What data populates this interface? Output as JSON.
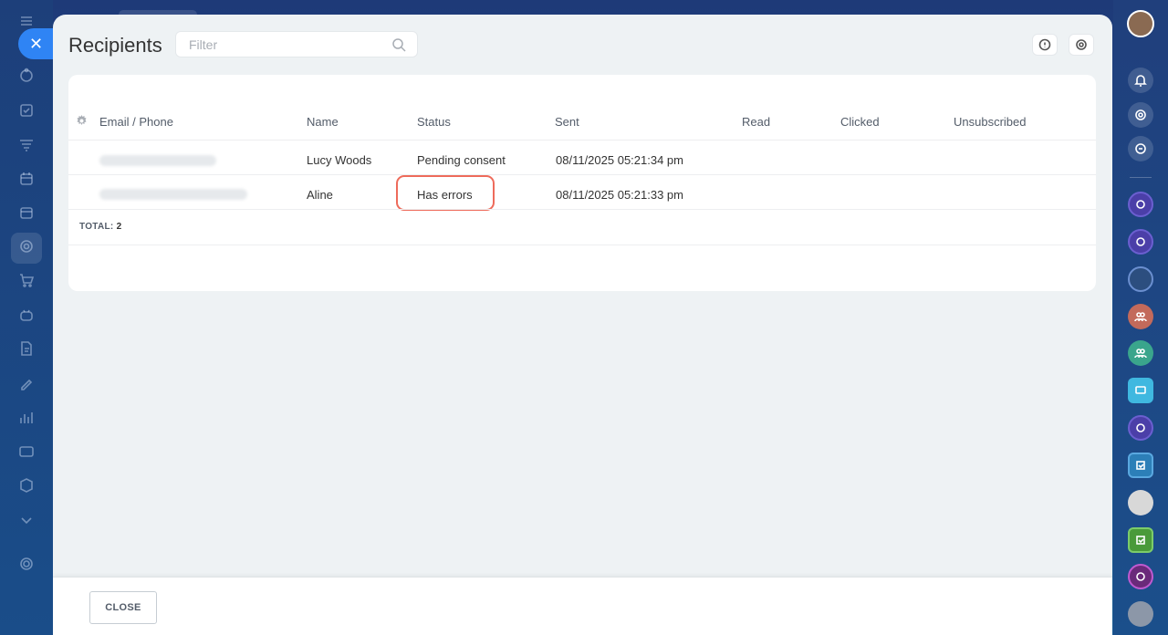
{
  "panel": {
    "title": "Recipients",
    "filter_placeholder": "Filter"
  },
  "table": {
    "columns": [
      "Email / Phone",
      "Name",
      "Status",
      "Sent",
      "Read",
      "Clicked",
      "Unsubscribed"
    ],
    "rows": [
      {
        "name": "Lucy Woods",
        "status": "Pending consent",
        "sent": "08/11/2025 05:21:34 pm"
      },
      {
        "name": "Aline",
        "status": "Has errors",
        "sent": "08/11/2025 05:21:33 pm"
      }
    ],
    "total_label": "TOTAL:",
    "total_value": "2"
  },
  "footer": {
    "close_label": "CLOSE"
  },
  "colors": {
    "accent": "#2f84f4",
    "highlight": "#ee6b5b"
  },
  "icons": {
    "left_sidebar": [
      "menu-icon",
      "crm-icon",
      "tasks-icon",
      "funnel-icon",
      "calendar-icon",
      "store-icon",
      "marketing-icon",
      "cart-icon",
      "robot-icon",
      "document-icon",
      "sign-icon",
      "analytics-icon",
      "chat-icon",
      "box-icon",
      "chevron-down-icon",
      "settings-icon"
    ],
    "right_sidebar": [
      "notifications-icon",
      "copilot-icon",
      "chat-search-icon"
    ]
  }
}
